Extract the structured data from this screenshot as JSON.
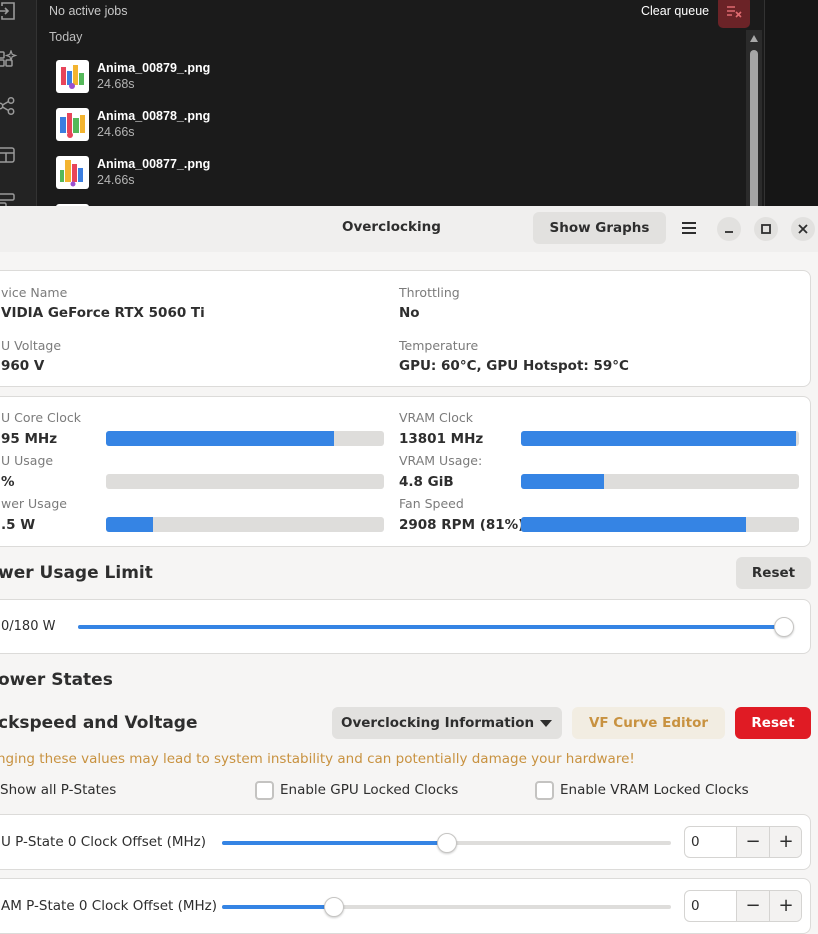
{
  "queue": {
    "status_text": "No active jobs",
    "clear_label": "Clear queue",
    "group_label": "Today",
    "jobs": [
      {
        "name": "Anima_00879_.png",
        "time": "24.68s"
      },
      {
        "name": "Anima_00878_.png",
        "time": "24.66s"
      },
      {
        "name": "Anima_00877_.png",
        "time": "24.66s"
      }
    ],
    "icons": [
      "logout-icon",
      "sparkle-shapes-icon",
      "workflow-icon",
      "layout-icon",
      "template-icon"
    ]
  },
  "window": {
    "title": "Overclocking",
    "show_graphs_label": "Show Graphs"
  },
  "device": {
    "name_label": "vice Name",
    "name_value": "VIDIA GeForce RTX 5060 Ti",
    "throttling_label": "Throttling",
    "throttling_value": "No",
    "voltage_label": "U Voltage",
    "voltage_value": "960 V",
    "temperature_label": "Temperature",
    "temperature_value": "GPU: 60°C, GPU Hotspot: 59°C"
  },
  "stats": {
    "core_clock_label": "U Core Clock",
    "core_clock_value": "95 MHz",
    "core_clock_fill": 0.82,
    "usage_label": "U Usage",
    "usage_value": "%",
    "usage_fill": 0.0,
    "power_label": "wer Usage",
    "power_value": ".5 W",
    "power_fill": 0.17,
    "vram_clock_label": "VRAM Clock",
    "vram_clock_value": "13801 MHz",
    "vram_clock_fill": 0.99,
    "vram_usage_label": "VRAM Usage:",
    "vram_usage_value": "4.8 GiB",
    "vram_usage_fill": 0.3,
    "fan_label": "Fan Speed",
    "fan_value": "2908 RPM (81%)",
    "fan_fill": 0.81
  },
  "power_limit": {
    "title": "wer Usage Limit",
    "reset_label": "Reset",
    "value": "0/180 W",
    "fraction": 1.0
  },
  "power_states": {
    "title": "ower States"
  },
  "clock": {
    "title": "ckspeed and Voltage",
    "info_label": "Overclocking Information",
    "vf_label": "VF Curve Editor",
    "reset_label": "Reset",
    "warning": "nging these values may lead to system instability and can potentially damage your hardware!",
    "show_pstates_label": "Show all P-States",
    "gpu_locked_label": "Enable GPU Locked Clocks",
    "vram_locked_label": "Enable VRAM Locked Clocks",
    "gpu_offset_label": "U P-State 0 Clock Offset (MHz)",
    "gpu_offset_value": "0",
    "gpu_offset_fraction": 0.5,
    "vram_offset_label": "AM P-State 0 Clock Offset (MHz)",
    "vram_offset_value": "0",
    "vram_offset_fraction": 0.25,
    "minus": "−",
    "plus": "+"
  },
  "colors": {
    "accent": "#3584e4",
    "danger": "#e01b24",
    "warning": "#c89240",
    "queue_bg": "#1b1b1b"
  }
}
